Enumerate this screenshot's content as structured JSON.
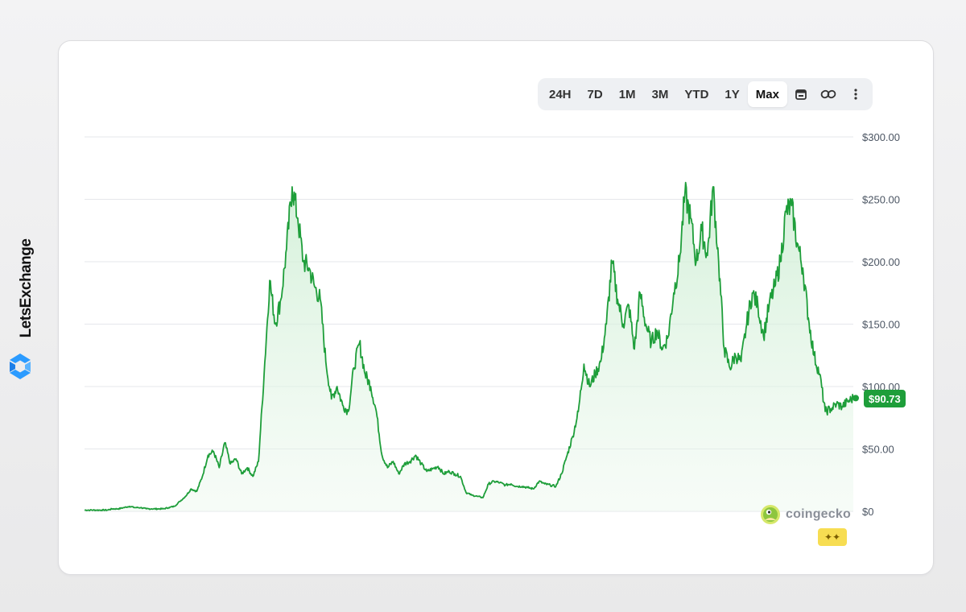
{
  "brand": {
    "name": "LetsExchange",
    "logo_icon": "letsexchange-logo-icon",
    "accent": "#1d8cf8"
  },
  "toolbar": {
    "ranges": [
      "24H",
      "7D",
      "1M",
      "3M",
      "YTD",
      "1Y",
      "Max"
    ],
    "active": "Max",
    "icons": [
      "calendar-icon",
      "link-icon",
      "more-vertical-icon"
    ]
  },
  "price_badge": "$90.73",
  "watermark": {
    "text": "coingecko",
    "badge_glyph": "✦✦"
  },
  "colors": {
    "line": "#1e9e3a",
    "fill": "#d9f2dd",
    "grid": "#e5e7eb",
    "badge": "#1e9e3a"
  },
  "chart_data": {
    "type": "area",
    "title": "",
    "xlabel": "",
    "ylabel": "",
    "ylim": [
      0,
      300
    ],
    "yticks": [
      "$300.00",
      "$250.00",
      "$200.00",
      "$150.00",
      "$100.00",
      "$50.00",
      "$0"
    ],
    "ytick_values": [
      300,
      250,
      200,
      150,
      100,
      50,
      0
    ],
    "grid": true,
    "series": [
      {
        "values": [
          1,
          1,
          1,
          1,
          1,
          2,
          2,
          3,
          4,
          3,
          3,
          2,
          2,
          2,
          2,
          3,
          4,
          8,
          12,
          18,
          16,
          28,
          45,
          48,
          35,
          55,
          38,
          42,
          30,
          35,
          28,
          40,
          110,
          185,
          150,
          170,
          210,
          260,
          235,
          200,
          195,
          180,
          170,
          120,
          90,
          100,
          85,
          80,
          115,
          135,
          110,
          100,
          80,
          45,
          35,
          40,
          30,
          38,
          40,
          45,
          38,
          32,
          34,
          36,
          30,
          32,
          30,
          28,
          15,
          13,
          12,
          11,
          22,
          24,
          23,
          21,
          22,
          20,
          20,
          19,
          18,
          24,
          22,
          21,
          20,
          30,
          45,
          60,
          80,
          118,
          100,
          110,
          120,
          150,
          200,
          170,
          150,
          165,
          130,
          175,
          150,
          135,
          145,
          130,
          140,
          175,
          200,
          255,
          235,
          200,
          225,
          205,
          260,
          200,
          130,
          115,
          125,
          120,
          150,
          175,
          165,
          140,
          165,
          180,
          200,
          240,
          245,
          215,
          195,
          155,
          125,
          110,
          80,
          82,
          86,
          84,
          88,
          90.73
        ]
      }
    ]
  }
}
